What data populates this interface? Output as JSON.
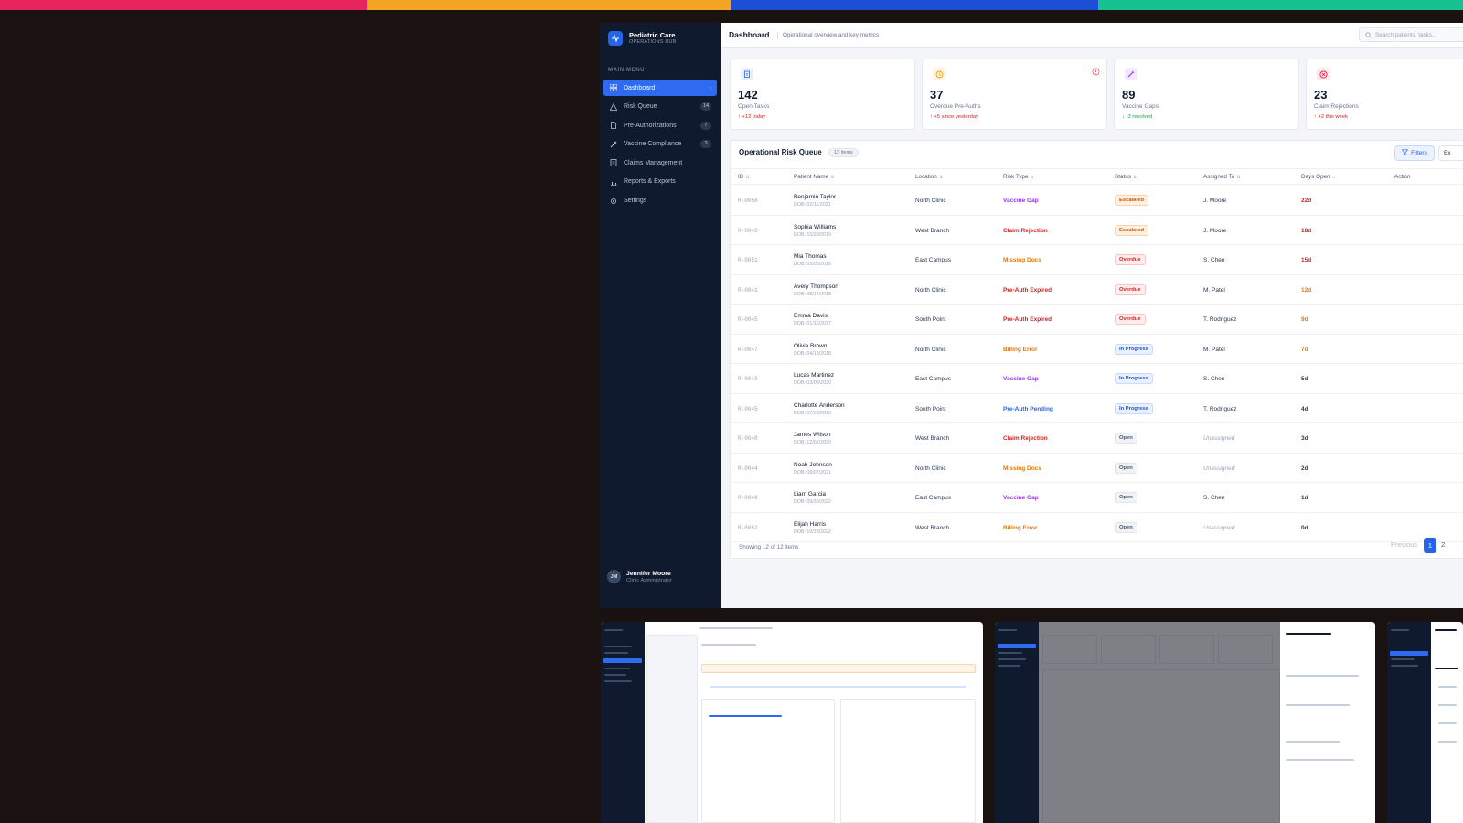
{
  "brand": {
    "name": "Pediatric Care",
    "sub": "OPERATIONS HUB"
  },
  "sidebar": {
    "menu_head": "MAIN MENU",
    "items": [
      {
        "label": "Dashboard",
        "badge": ""
      },
      {
        "label": "Risk Queue",
        "badge": "14"
      },
      {
        "label": "Pre-Authorizations",
        "badge": "7"
      },
      {
        "label": "Vaccine Compliance",
        "badge": "3"
      },
      {
        "label": "Claims Management",
        "badge": ""
      },
      {
        "label": "Reports & Exports",
        "badge": ""
      },
      {
        "label": "Settings",
        "badge": ""
      }
    ],
    "user": {
      "initials": "JM",
      "name": "Jennifer Moore",
      "role": "Clinic Administrator"
    }
  },
  "header": {
    "title": "Dashboard",
    "subtitle": "Operational overview and key metrics",
    "search_placeholder": "Search patients, tasks..."
  },
  "stats": [
    {
      "value": "142",
      "label": "Open Tasks",
      "delta": "↑ +12 today",
      "color": "#2563eb",
      "delta_color": "#d21f1f"
    },
    {
      "value": "37",
      "label": "Overdue Pre-Auths",
      "delta": "↑ +5 since yesterday",
      "color": "#f59e0b",
      "delta_color": "#d21f1f"
    },
    {
      "value": "89",
      "label": "Vaccine Gaps",
      "delta": "↓ -3 resolved",
      "color": "#a855f7",
      "delta_color": "#16a34a"
    },
    {
      "value": "23",
      "label": "Claim Rejections",
      "delta": "↑ +2 this week",
      "color": "#e11d48",
      "delta_color": "#d21f1f"
    }
  ],
  "queue": {
    "title": "Operational Risk Queue",
    "count": "12 items",
    "filters_label": "Filters",
    "export_label": "Ex",
    "columns": [
      "ID",
      "Patient Name",
      "Location",
      "Risk Type",
      "Status",
      "Assigned To",
      "Days Open",
      "Action"
    ],
    "rows": [
      {
        "id": "R-0058",
        "name": "Benjamin Taylor",
        "dob": "DOB: 02/11/2021",
        "loc": "North Clinic",
        "risk": "Vaccine Gap",
        "status": "Escalated",
        "assign": "J. Moore",
        "days": "22d"
      },
      {
        "id": "R-0043",
        "name": "Sophia Williams",
        "dob": "DOB: 10/29/2019",
        "loc": "West Branch",
        "risk": "Claim Rejection",
        "status": "Escalated",
        "assign": "J. Moore",
        "days": "18d"
      },
      {
        "id": "R-0051",
        "name": "Mia Thomas",
        "dob": "DOB: 05/05/2016",
        "loc": "East Campus",
        "risk": "Missing Docs",
        "status": "Overdue",
        "assign": "S. Chen",
        "days": "15d"
      },
      {
        "id": "R-0041",
        "name": "Avery Thompson",
        "dob": "DOB: 08/14/2018",
        "loc": "North Clinic",
        "risk": "Pre-Auth Expired",
        "status": "Overdue",
        "assign": "M. Patel",
        "days": "12d"
      },
      {
        "id": "R-0045",
        "name": "Emma Davis",
        "dob": "DOB: 01/15/2017",
        "loc": "South Point",
        "risk": "Pre-Auth Expired",
        "status": "Overdue",
        "assign": "T. Rodriguez",
        "days": "9d"
      },
      {
        "id": "R-0047",
        "name": "Olivia Brown",
        "dob": "DOB: 04/18/2018",
        "loc": "North Clinic",
        "risk": "Billing Error",
        "status": "In Progress",
        "assign": "M. Patel",
        "days": "7d"
      },
      {
        "id": "R-0043",
        "name": "Lucas Martinez",
        "dob": "DOB: 03/03/2020",
        "loc": "East Campus",
        "risk": "Vaccine Gap",
        "status": "In Progress",
        "assign": "S. Chen",
        "days": "5d"
      },
      {
        "id": "R-0045",
        "name": "Charlotte Anderson",
        "dob": "DOB: 07/23/2019",
        "loc": "South Point",
        "risk": "Pre-Auth Pending",
        "status": "In Progress",
        "assign": "T. Rodriguez",
        "days": "4d"
      },
      {
        "id": "R-0048",
        "name": "James Wilson",
        "dob": "DOB: 12/02/2020",
        "loc": "West Branch",
        "risk": "Claim Rejection",
        "status": "Open",
        "assign": "Unassigned",
        "days": "3d"
      },
      {
        "id": "R-0044",
        "name": "Noah Johnson",
        "dob": "DOB: 08/07/2021",
        "loc": "North Clinic",
        "risk": "Missing Docs",
        "status": "Open",
        "assign": "Unassigned",
        "days": "2d"
      },
      {
        "id": "R-0049",
        "name": "Liam Garcia",
        "dob": "DOB: 09/30/2022",
        "loc": "East Campus",
        "risk": "Vaccine Gap",
        "status": "Open",
        "assign": "S. Chen",
        "days": "1d"
      },
      {
        "id": "R-0052",
        "name": "Elijah Harris",
        "dob": "DOB: 10/28/2022",
        "loc": "West Branch",
        "risk": "Billing Error",
        "status": "Open",
        "assign": "Unassigned",
        "days": "0d"
      }
    ],
    "footer": "Showing 12 of 12 items",
    "prev_label": "Previous",
    "page_current": "1",
    "page_next": "2"
  },
  "colors": {
    "risk": {
      "Vaccine Gap": "#9333ea",
      "Claim Rejection": "#d21f1f",
      "Missing Docs": "#e0790b",
      "Pre-Auth Expired": "#d21f1f",
      "Billing Error": "#e0790b",
      "Pre-Auth Pending": "#2563eb"
    },
    "days_red": "#d21f1f",
    "days_orange": "#e0790b",
    "days_default": "#2b3850"
  }
}
